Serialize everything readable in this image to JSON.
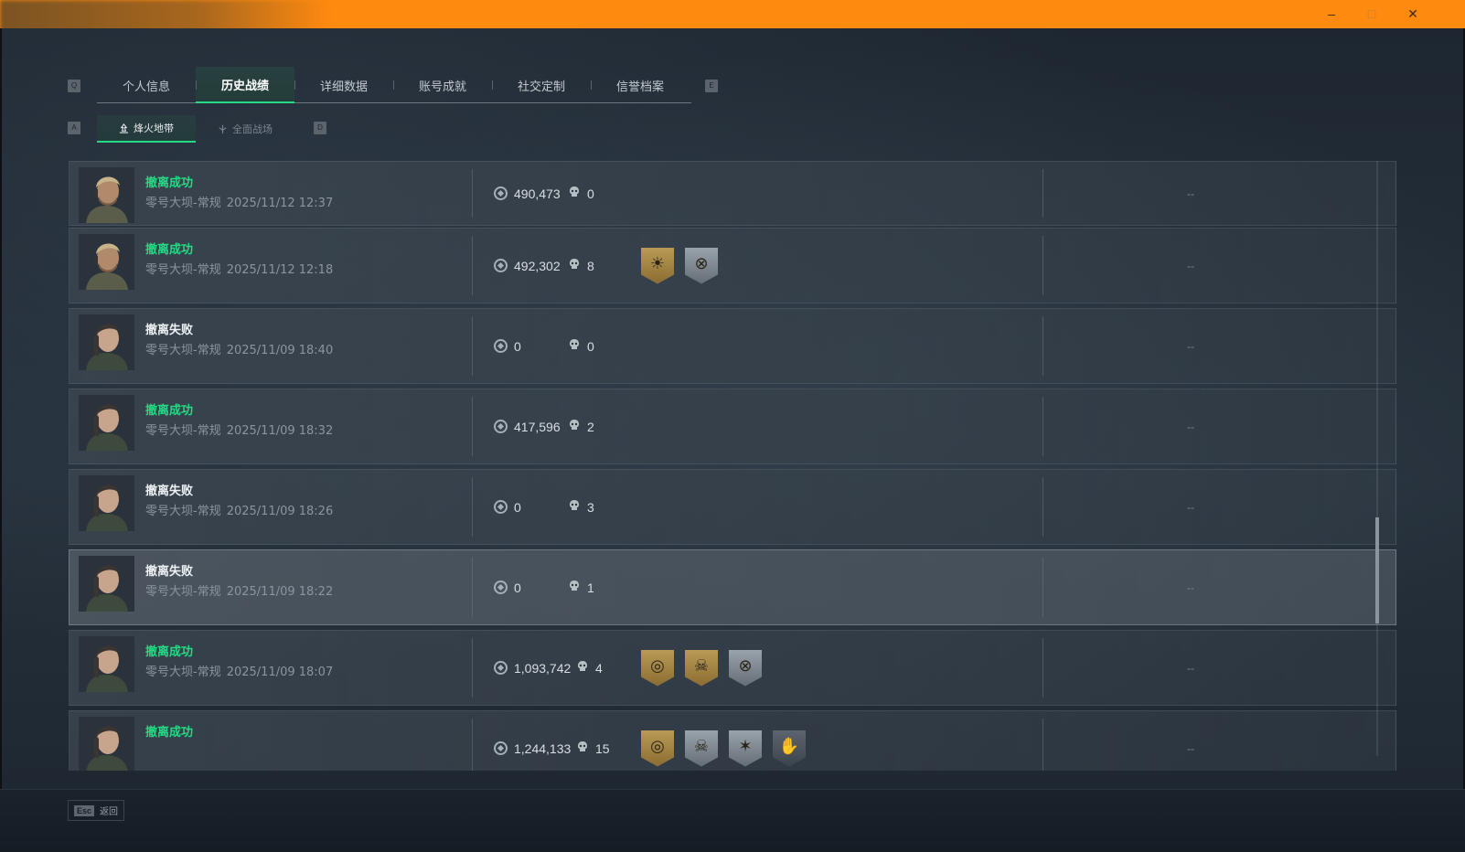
{
  "window": {
    "minimize": "–",
    "maximize": "□",
    "close": "✕"
  },
  "tabs": {
    "prev_key": "Q",
    "next_key": "E",
    "items": [
      {
        "label": "个人信息"
      },
      {
        "label": "历史战绩"
      },
      {
        "label": "详细数据"
      },
      {
        "label": "账号成就"
      },
      {
        "label": "社交定制"
      },
      {
        "label": "信誉档案"
      }
    ],
    "active": 1
  },
  "subtabs": {
    "prev_key": "A",
    "next_key": "D",
    "items": [
      {
        "label": "烽火地带",
        "icon": "fire-zone-icon"
      },
      {
        "label": "全面战场",
        "icon": "battlefield-icon"
      }
    ],
    "active": 0
  },
  "records": [
    {
      "status": "撤离成功",
      "map": "零号大坝-常规",
      "datetime": "2025/11/12 12:37",
      "value": "490,473",
      "kills": "0",
      "badges": [],
      "extra": "--",
      "avatar": "male-operator"
    },
    {
      "status": "撤离成功",
      "map": "零号大坝-常规",
      "datetime": "2025/11/12 12:18",
      "value": "492,302",
      "kills": "8",
      "badges": [
        "gold-sun-badge",
        "silver-crosshair-badge"
      ],
      "extra": "--",
      "avatar": "male-operator"
    },
    {
      "status": "撤离失败",
      "map": "零号大坝-常规",
      "datetime": "2025/11/09 18:40",
      "value": "0",
      "kills": "0",
      "badges": [],
      "extra": "--",
      "avatar": "female-operator"
    },
    {
      "status": "撤离成功",
      "map": "零号大坝-常规",
      "datetime": "2025/11/09 18:32",
      "value": "417,596",
      "kills": "2",
      "badges": [],
      "extra": "--",
      "avatar": "female-operator"
    },
    {
      "status": "撤离失败",
      "map": "零号大坝-常规",
      "datetime": "2025/11/09 18:26",
      "value": "0",
      "kills": "3",
      "badges": [],
      "extra": "--",
      "avatar": "female-operator"
    },
    {
      "status": "撤离失败",
      "map": "零号大坝-常规",
      "datetime": "2025/11/09 18:22",
      "value": "0",
      "kills": "1",
      "badges": [],
      "extra": "--",
      "avatar": "female-operator"
    },
    {
      "status": "撤离成功",
      "map": "零号大坝-常规",
      "datetime": "2025/11/09 18:07",
      "value": "1,093,742",
      "kills": "4",
      "badges": [
        "gold-coin-badge",
        "gold-skull-badge",
        "silver-crosshair-badge"
      ],
      "extra": "--",
      "avatar": "female-operator"
    },
    {
      "status": "撤离成功",
      "map": "",
      "datetime": "",
      "value": "1,244,133",
      "kills": "15",
      "badges": [
        "gold-coin-badge",
        "silver-skull-badge",
        "silver-star-badge",
        "dark-hand-badge"
      ],
      "extra": "--",
      "avatar": "female-operator"
    }
  ],
  "footer": {
    "esc_key": "Esc",
    "esc_label": "返回"
  },
  "colors": {
    "titlebar": "#ff8a10",
    "success": "#27d884",
    "failure": "#eef1f4",
    "active_tab_underline": "#27d884"
  }
}
